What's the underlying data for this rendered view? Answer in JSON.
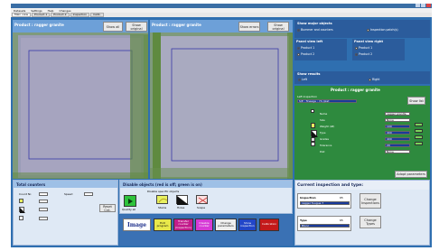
{
  "window": {
    "title": ""
  },
  "menu": [
    "Datasets",
    "Settings",
    "Help",
    "Changes"
  ],
  "tabs": [
    "Main view",
    "Product 1",
    "Product 2",
    "Inspection",
    "Calib."
  ],
  "left_view": {
    "title": "Product : ragger granite",
    "show_all": "Show all",
    "show_original": "Show original"
  },
  "right_view": {
    "title": "Product : ragger granite",
    "show_errors": "Show errors",
    "show_original": "Show original"
  },
  "show_major_defects": {
    "title": "Show major objects",
    "options": [
      "Bummer and counters",
      "Inspection patch(s)"
    ]
  },
  "panel_view_left": {
    "title": "Panel view left",
    "options": [
      "Product 1",
      "Product 2"
    ]
  },
  "panel_view_right": {
    "title": "Panel view right",
    "options": [
      "Product 1",
      "Product 2"
    ]
  },
  "show_results": {
    "title": "Show results",
    "options": [
      "Left",
      "Right"
    ]
  },
  "product_panel": {
    "title": "Product : ragger granite",
    "subtitle": "Left inspection",
    "dropdown": "S/E : fineage : 74 /plat",
    "show_list": "Show list",
    "rows": [
      {
        "label": "Name",
        "value": "ragger granite"
      },
      {
        "label": "Size",
        "value": "None"
      },
      {
        "label": "Weight (LB)",
        "value": "100"
      },
      {
        "label": "Type",
        "value": "400"
      },
      {
        "label": "Grades",
        "value": "400"
      },
      {
        "label": "Tolerance",
        "value": "20"
      },
      {
        "label": "Dist",
        "value": "None"
      }
    ],
    "adopt": "Adopt parameters"
  },
  "total_counters": {
    "title": "Total counters",
    "count_label": "Count Nr.",
    "speed_label": "Speed",
    "reset": "Reset Cnt."
  },
  "disable_objects": {
    "title": "Disable objects (red is off; green is on)",
    "subtitle": "Disable specific objects",
    "main_label": "Quality all",
    "items": [
      "Stains",
      "Holes",
      "Scape"
    ]
  },
  "toolbar": {
    "logo": "Image",
    "buttons": [
      {
        "label": "Exit program",
        "color": "#e8e84a"
      },
      {
        "label": "Transfer counter (Inspection)",
        "color": "#c21b8b"
      },
      {
        "label": "Disable counter",
        "color": "#d63ad6"
      },
      {
        "label": "Change parameters",
        "color": "#eeeeee"
      },
      {
        "label": "Show inspection",
        "color": "#2246c8"
      },
      {
        "label": "Calibration",
        "color": "#c41a1a"
      }
    ]
  },
  "current_inspection": {
    "title": "Current inspection and type:",
    "inspection_label": "Inspection",
    "inspection_value": "ragger fougue 7",
    "inspection_num": "65",
    "type_label": "Type",
    "type_value": "Blanc",
    "type_num": "65",
    "change_inspections": "Change Inspections",
    "change_types": "Change Types"
  }
}
